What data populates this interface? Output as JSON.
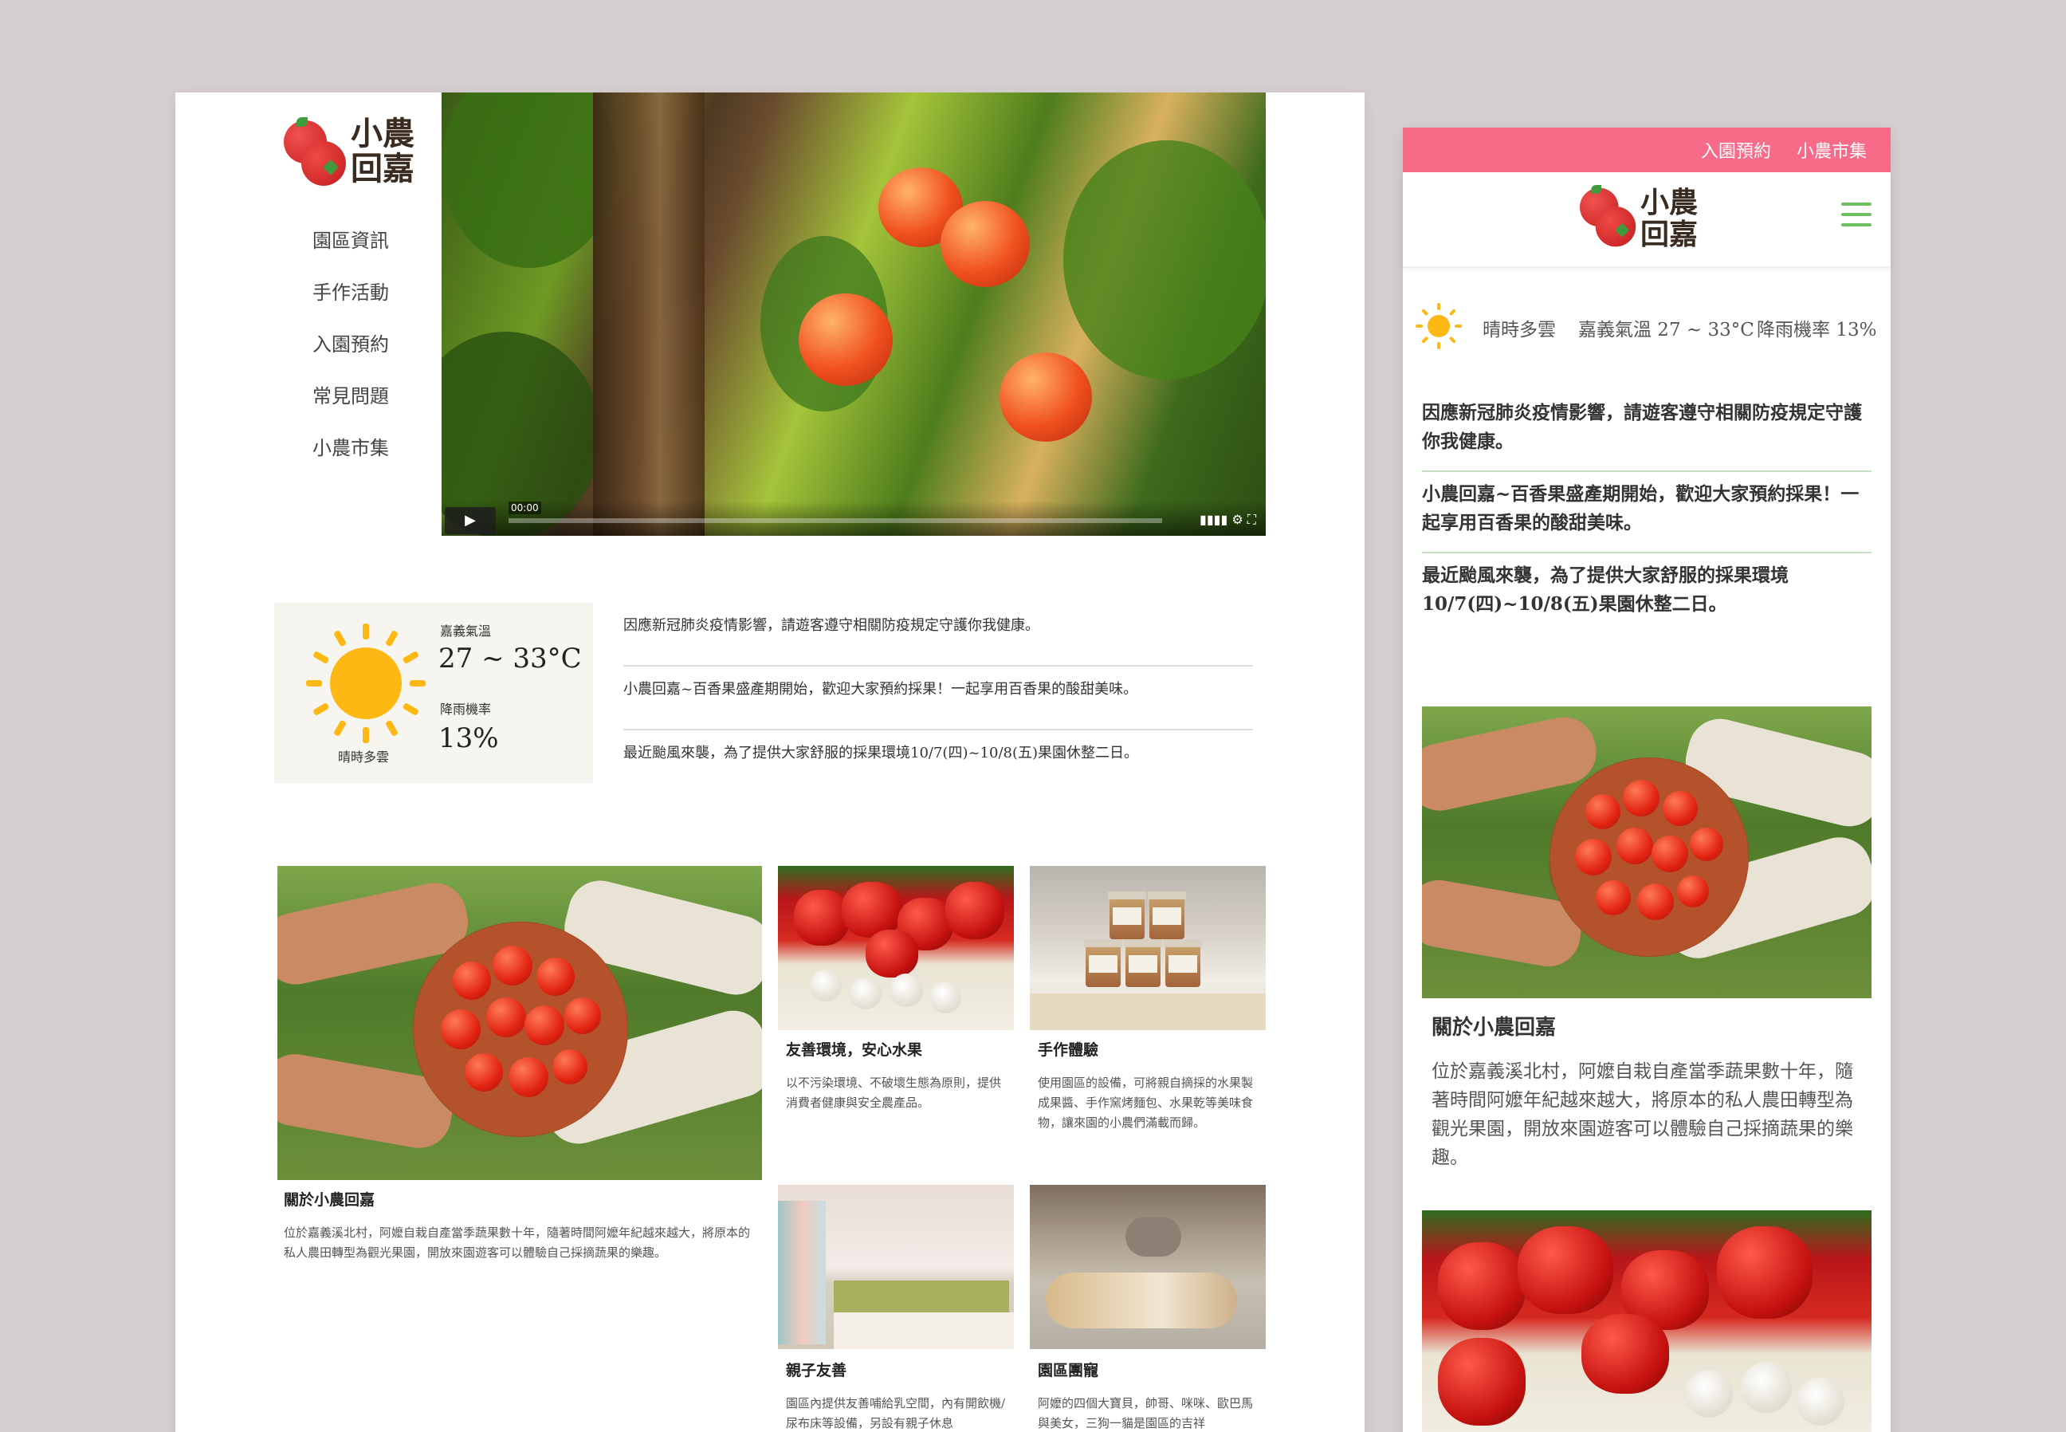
{
  "brand": {
    "name_line1": "小農",
    "name_line2": "回嘉"
  },
  "nav": [
    "園區資訊",
    "手作活動",
    "入園預約",
    "常見問題",
    "小農市集"
  ],
  "video": {
    "time": "00:00",
    "play_icon": "▶",
    "settings_icon": "⚙",
    "fullscreen_icon": "⛶",
    "volume_icon": "volume-icon"
  },
  "weather": {
    "temp_label": "嘉義氣溫",
    "temp": "27 ~ 33°C",
    "rain_label": "降雨機率",
    "rain": "13%",
    "condition": "晴時多雲"
  },
  "news": [
    "因應新冠肺炎疫情影響，請遊客遵守相關防疫規定守護你我健康。",
    "小農回嘉~百香果盛產期開始，歡迎大家預約採果！一起享用百香果的酸甜美味。",
    "最近颱風來襲，為了提供大家舒服的採果環境10/7(四)~10/8(五)果園休整二日。"
  ],
  "cards": {
    "about": {
      "title": "關於小農回嘉",
      "text": "位於嘉義溪北村，阿嬤自栽自產當季蔬果數十年，隨著時間阿嬤年紀越來越大，將原本的私人農田轉型為觀光果園，開放來園遊客可以體驗自己採摘蔬果的樂趣。"
    },
    "eco": {
      "title": "友善環境，安心水果",
      "text": "以不污染環境、不破壞生態為原則，提供消費者健康與安全農產品。"
    },
    "diy": {
      "title": "手作體驗",
      "text": "使用園區的設備，可將親自摘採的水果製成果醬、手作窯烤麵包、水果乾等美味食物，讓來園的小農們滿載而歸。"
    },
    "family": {
      "title": "親子友善",
      "text": "園區內提供友善哺給乳空間，內有開飲機/尿布床等設備，另設有親子休息"
    },
    "pets": {
      "title": "園區團寵",
      "text": "阿嬤的四個大寶貝，帥哥、咪咪、歐巴馬與美女，三狗一貓是園區的吉祥"
    }
  },
  "mobile": {
    "top_links": [
      "入園預約",
      "小農市集"
    ],
    "weather_line": {
      "condition": "晴時多雲",
      "temp": "嘉義氣溫 27 ~ 33°C",
      "rain": "降雨機率 13%"
    },
    "news": [
      "因應新冠肺炎疫情影響，請遊客遵守相關防疫規定守護你我健康。",
      "小農回嘉~百香果盛產期開始，歡迎大家預約採果！一起享用百香果的酸甜美味。",
      "最近颱風來襲，為了提供大家舒服的採果環境10/7(四)~10/8(五)果園休整二日。"
    ],
    "about_title": "關於小農回嘉",
    "about_text": "位於嘉義溪北村，阿嬤自栽自產當季蔬果數十年，隨著時間阿嬤年紀越來越大，將原本的私人農田轉型為觀光果園，開放來園遊客可以體驗自己採摘蔬果的樂趣。"
  },
  "colors": {
    "background": "#d6cfd0",
    "mobile_topbar": "#f76b88",
    "sun": "#fdb813",
    "menu_green": "#6dbf5f",
    "tomato_red": "#d9261c"
  }
}
